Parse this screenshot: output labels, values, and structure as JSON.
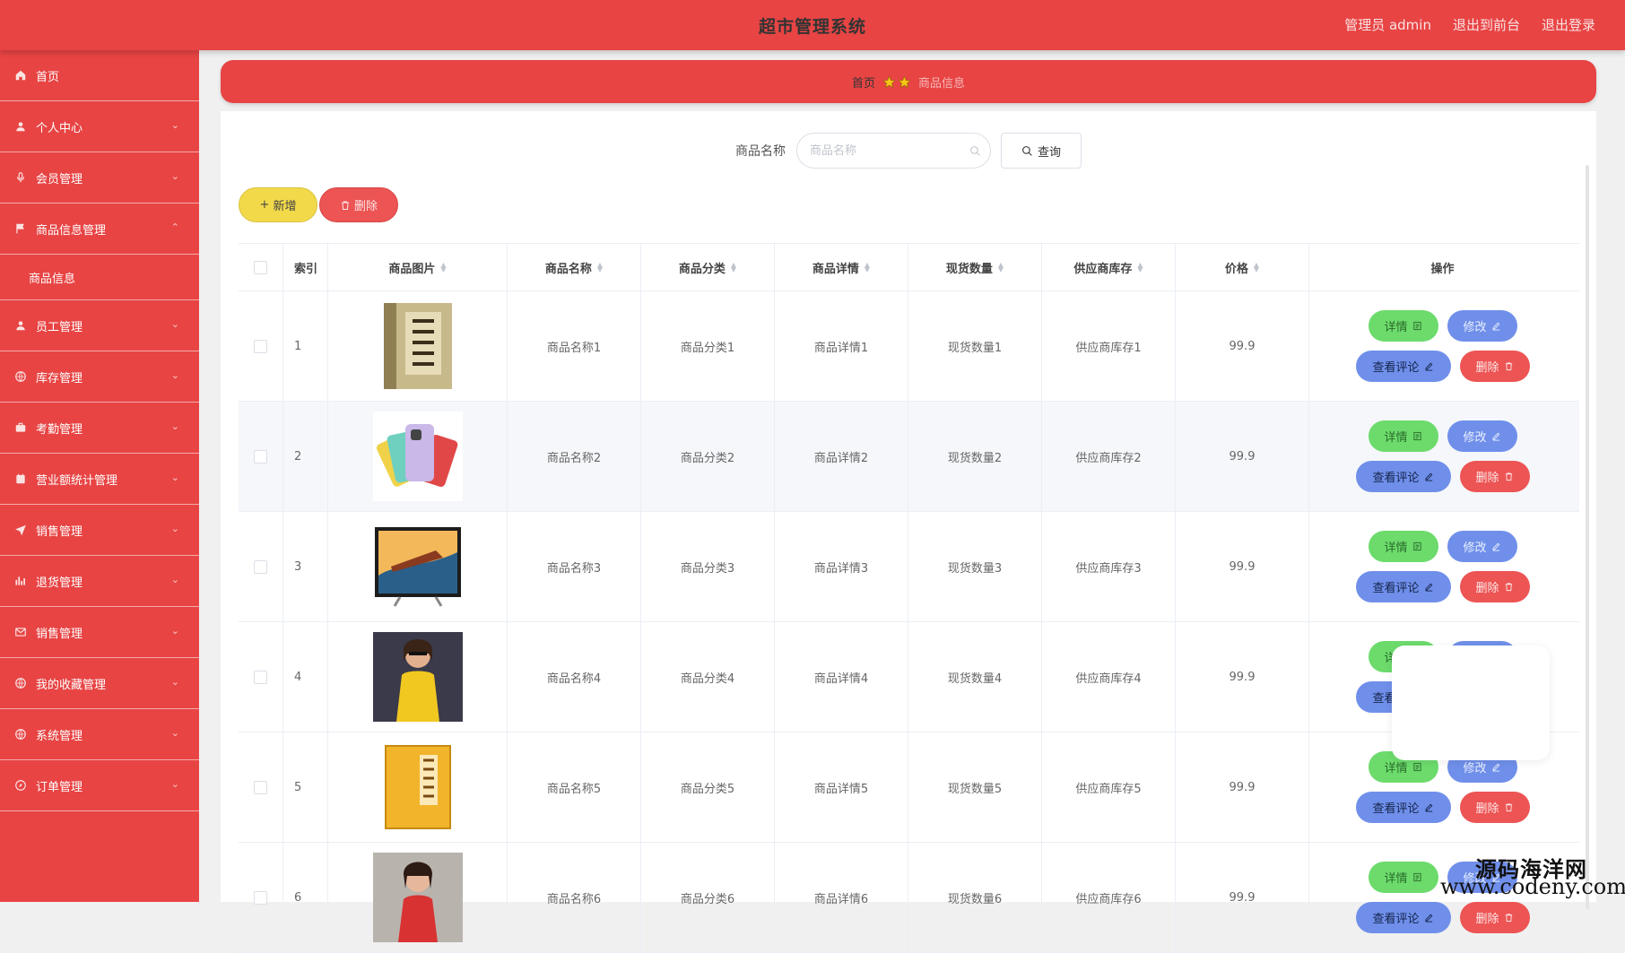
{
  "header": {
    "title": "超市管理系统",
    "user": "管理员 admin",
    "back_front": "退出到前台",
    "logout": "退出登录"
  },
  "sidebar": {
    "items": [
      {
        "label": "首页",
        "icon": "home-icon",
        "chevron": ""
      },
      {
        "label": "个人中心",
        "icon": "user-icon",
        "chevron": "⌄"
      },
      {
        "label": "会员管理",
        "icon": "mic-icon",
        "chevron": "⌄"
      },
      {
        "label": "商品信息管理",
        "icon": "flag-icon",
        "chevron": "⌃",
        "sub": "商品信息"
      },
      {
        "label": "员工管理",
        "icon": "user-icon",
        "chevron": "⌄"
      },
      {
        "label": "库存管理",
        "icon": "globe-icon",
        "chevron": "⌄"
      },
      {
        "label": "考勤管理",
        "icon": "briefcase-icon",
        "chevron": "⌄"
      },
      {
        "label": "营业额统计管理",
        "icon": "calendar-icon",
        "chevron": "⌄"
      },
      {
        "label": "销售管理",
        "icon": "send-icon",
        "chevron": "⌄"
      },
      {
        "label": "退货管理",
        "icon": "chart-icon",
        "chevron": "⌄"
      },
      {
        "label": "销售管理",
        "icon": "mail-icon",
        "chevron": "⌄"
      },
      {
        "label": "我的收藏管理",
        "icon": "globe-icon",
        "chevron": "⌄"
      },
      {
        "label": "系统管理",
        "icon": "globe-icon",
        "chevron": "⌄"
      },
      {
        "label": "订单管理",
        "icon": "compass-icon",
        "chevron": "⌄"
      }
    ]
  },
  "breadcrumb": {
    "home": "首页",
    "current": "商品信息"
  },
  "search": {
    "label": "商品名称",
    "placeholder": "商品名称",
    "button": "查询"
  },
  "actions": {
    "add": "新增",
    "delete": "删除"
  },
  "table": {
    "headers": [
      "索引",
      "商品图片",
      "商品名称",
      "商品分类",
      "商品详情",
      "现货数量",
      "供应商库存",
      "价格",
      "操作"
    ],
    "buttons": {
      "detail": "详情",
      "edit": "修改",
      "review": "查看评论",
      "delete": "删除"
    },
    "rows": [
      {
        "index": "1",
        "image": "book-cover",
        "name": "商品名称1",
        "category": "商品分类1",
        "detail": "商品详情1",
        "stock": "现货数量1",
        "supplier": "供应商库存1",
        "price": "99.9"
      },
      {
        "index": "2",
        "image": "phones",
        "name": "商品名称2",
        "category": "商品分类2",
        "detail": "商品详情2",
        "stock": "现货数量2",
        "supplier": "供应商库存2",
        "price": "99.9"
      },
      {
        "index": "3",
        "image": "tv",
        "name": "商品名称3",
        "category": "商品分类3",
        "detail": "商品详情3",
        "stock": "现货数量3",
        "supplier": "供应商库存3",
        "price": "99.9"
      },
      {
        "index": "4",
        "image": "woman-yellow",
        "name": "商品名称4",
        "category": "商品分类4",
        "detail": "商品详情4",
        "stock": "现货数量4",
        "supplier": "供应商库存4",
        "price": "99.9"
      },
      {
        "index": "5",
        "image": "yellow-book",
        "name": "商品名称5",
        "category": "商品分类5",
        "detail": "商品详情5",
        "stock": "现货数量5",
        "supplier": "供应商库存5",
        "price": "99.9"
      },
      {
        "index": "6",
        "image": "woman-red",
        "name": "商品名称6",
        "category": "商品分类6",
        "detail": "商品详情6",
        "stock": "现货数量6",
        "supplier": "供应商库存6",
        "price": "99.9"
      }
    ]
  },
  "watermark": {
    "line1": "源码海洋网",
    "line2": "www.codeny.com"
  },
  "colors": {
    "primary": "#e84444",
    "success": "#6cdb6c",
    "info": "#6f8fea",
    "warn": "#f2d94a"
  }
}
